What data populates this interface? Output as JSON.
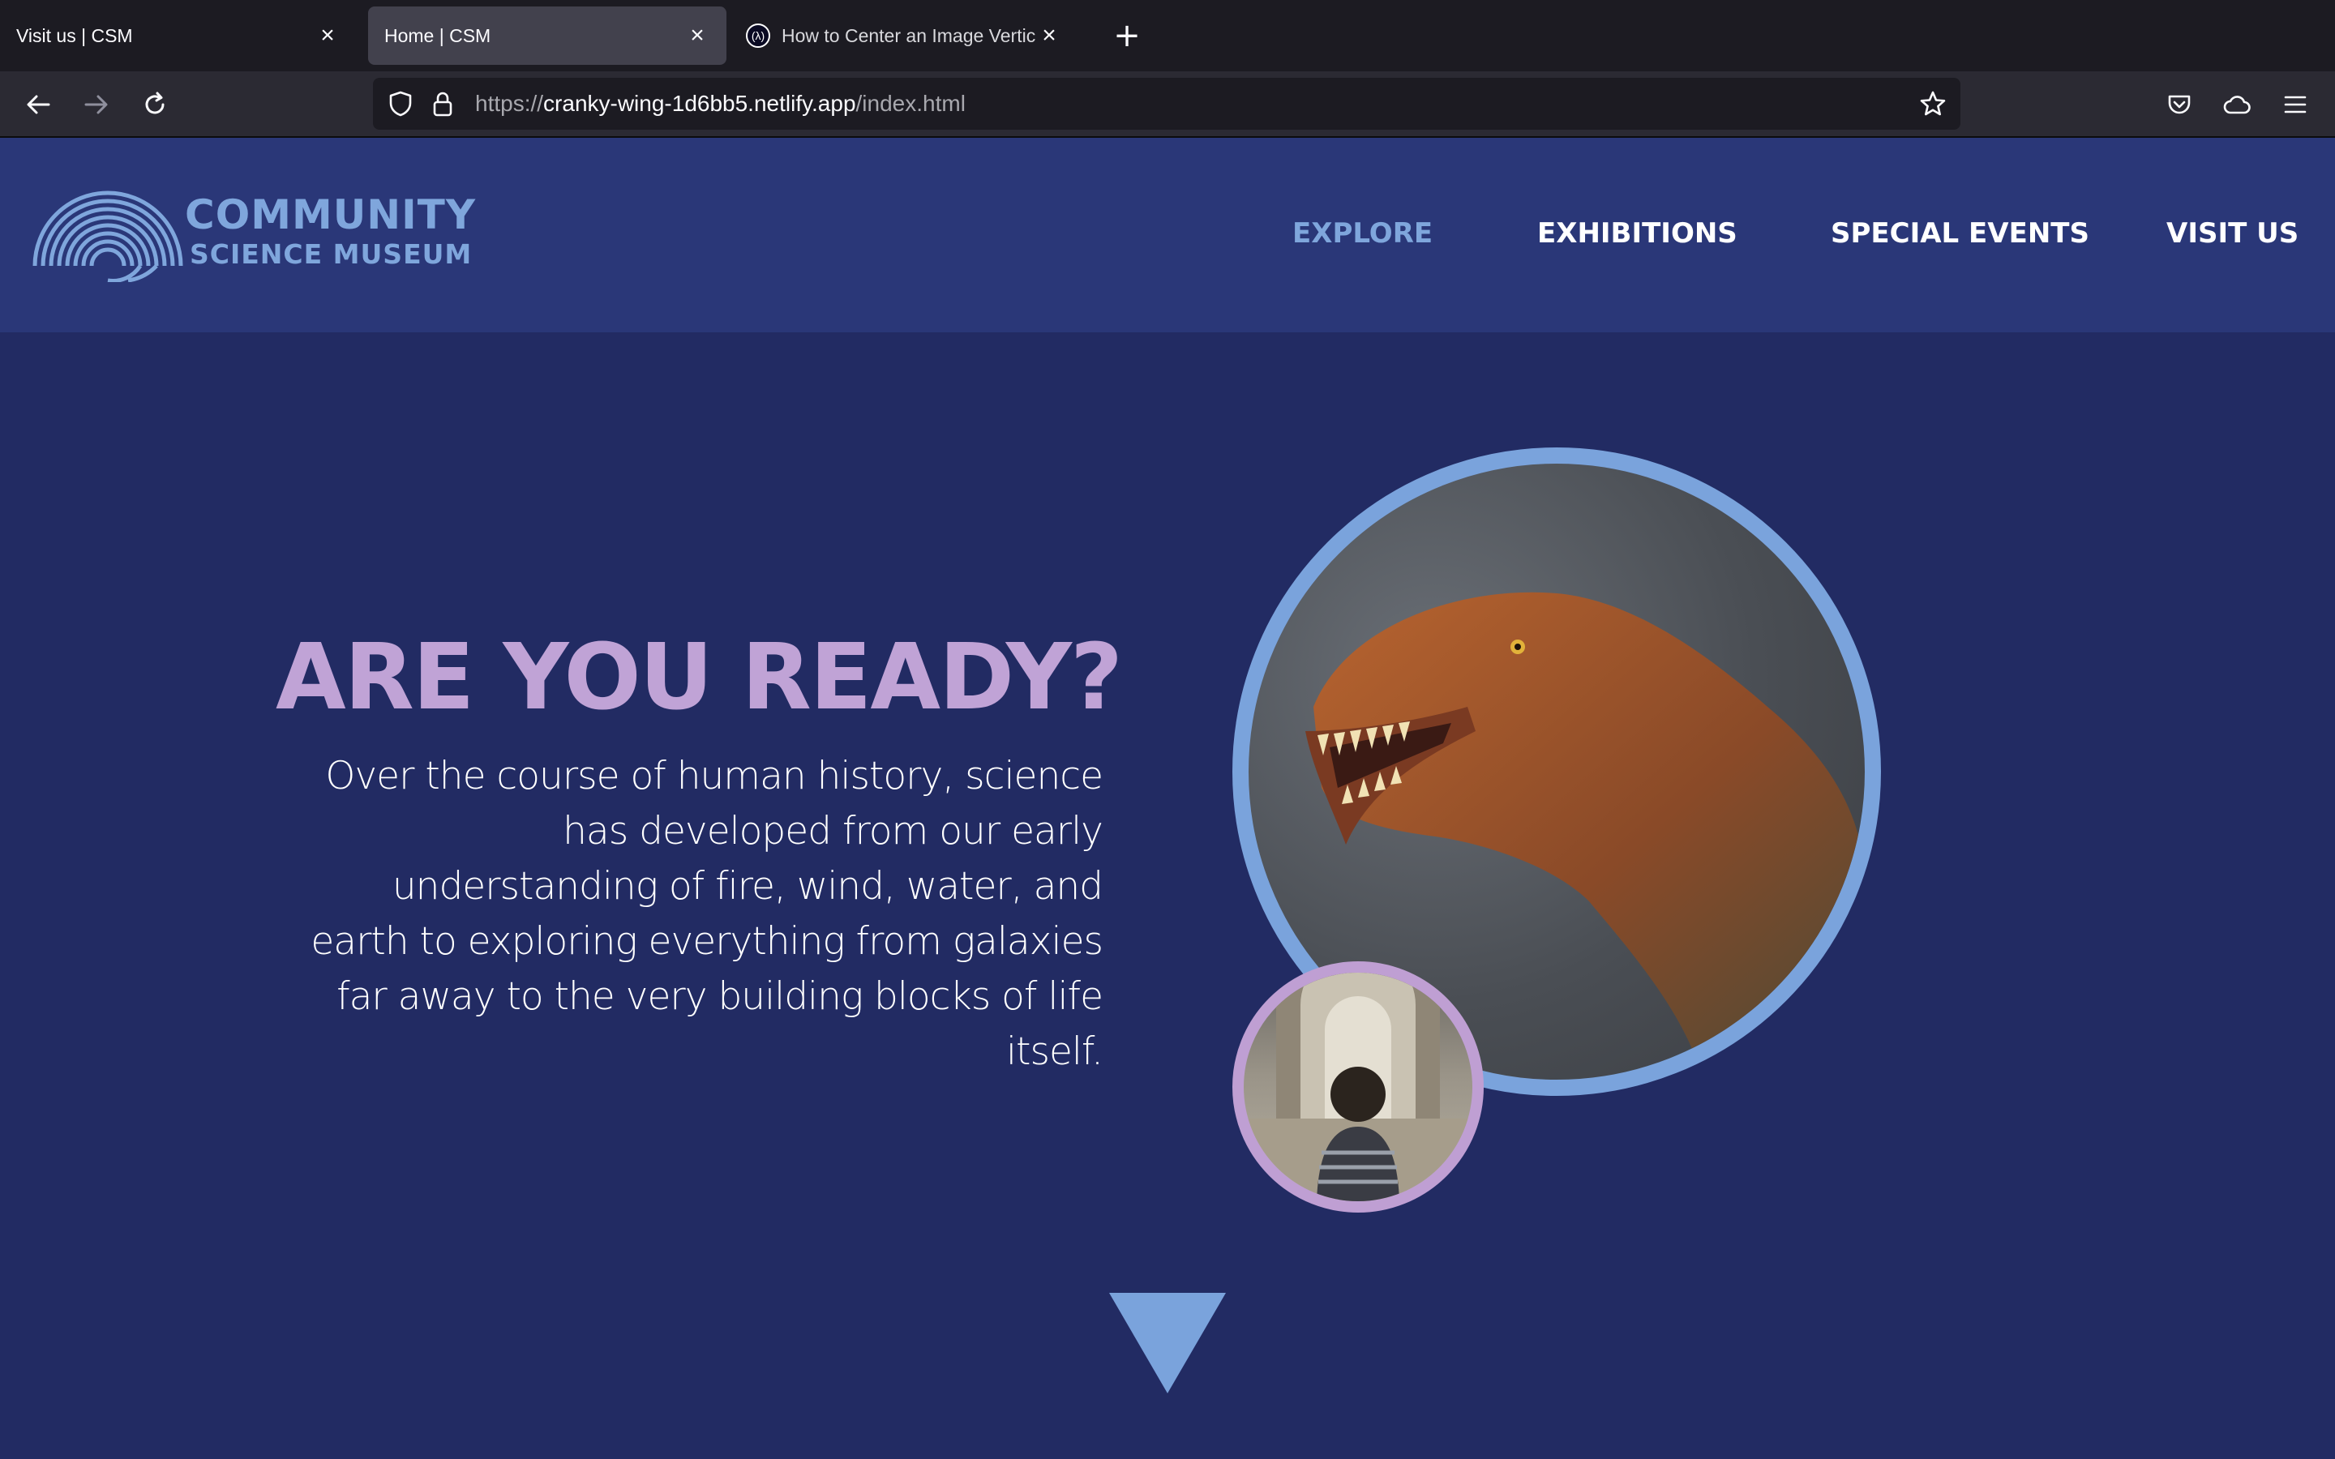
{
  "browser": {
    "tabs": [
      {
        "title": "Visit us | CSM",
        "active": false
      },
      {
        "title": "Home | CSM",
        "active": true
      },
      {
        "title": "How to Center an Image Vertica",
        "active": false
      }
    ],
    "url": {
      "scheme": "https://",
      "host": "cranky-wing-1d6bb5.netlify.app",
      "path": "/index.html"
    }
  },
  "site": {
    "logo": {
      "line1": "COMMUNITY",
      "line2": "SCIENCE MUSEUM"
    },
    "nav": [
      {
        "label": "EXPLORE",
        "current": true
      },
      {
        "label": "EXHIBITIONS",
        "current": false
      },
      {
        "label": "SPECIAL EVENTS",
        "current": false
      },
      {
        "label": "VISIT US",
        "current": false
      }
    ]
  },
  "hero": {
    "title": "ARE YOU READY?",
    "body": "Over the course of human history, science has developed from our early understanding of fire, wind, water, and earth to exploring everything from galaxies far away to the very building blocks of life itself."
  },
  "colors": {
    "page_bg": "#222b63",
    "header_bg": "#2a3778",
    "accent_blue": "#7fa6dc",
    "accent_lavender": "#c0a3d6"
  }
}
